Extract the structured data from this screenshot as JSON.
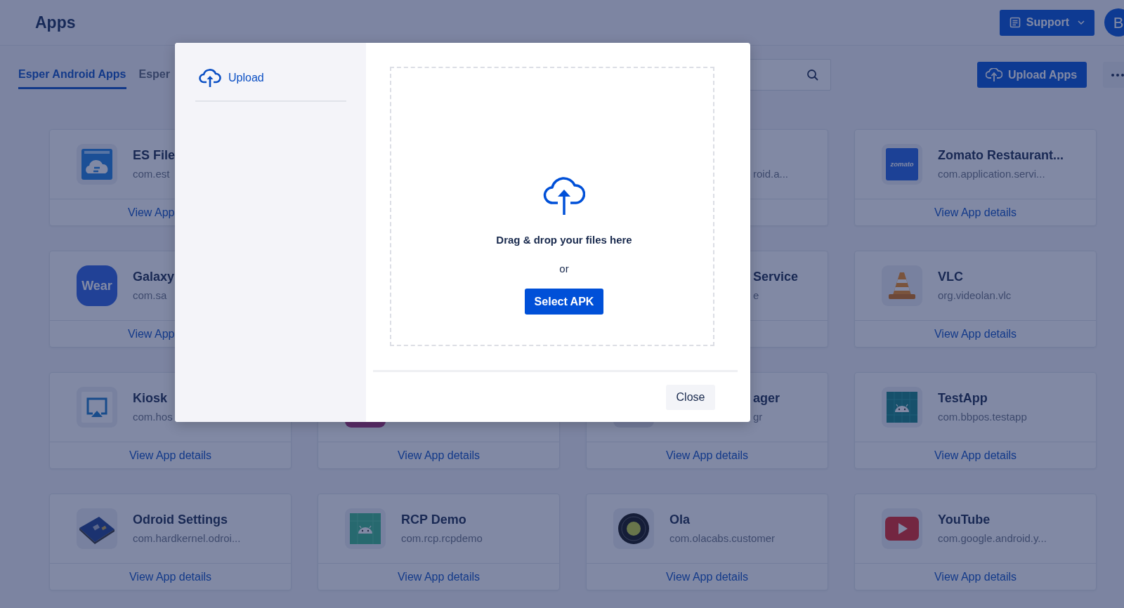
{
  "header": {
    "title": "Apps",
    "support_button": "Support",
    "avatar": "B"
  },
  "tabs": [
    {
      "label": "Esper Android Apps",
      "selected": true
    },
    {
      "label": "Esper",
      "selected": false
    }
  ],
  "upload_button": "Upload Apps",
  "card_rows": [
    [
      {
        "kind": "folder",
        "name": "ES File",
        "package": "com.est",
        "link": "View App"
      },
      {},
      {
        "package": "roid.a..."
      },
      {
        "kind": "zomato",
        "icon_label": "zomato",
        "name": "Zomato Restaurant...",
        "package": "com.application.servi...",
        "link": "View App details"
      }
    ],
    [
      {
        "kind": "wear",
        "icon_label": "Wear",
        "name": "Galaxy",
        "package": "com.sa",
        "link": "View App"
      },
      {},
      {
        "name": "Service",
        "package": "e"
      },
      {
        "kind": "cone",
        "name": "VLC",
        "package": "org.videolan.vlc",
        "link": "View App details"
      }
    ],
    [
      {
        "kind": "screen",
        "name": "Kiosk",
        "package": "com.hos",
        "link": "View App details"
      },
      {
        "kind": "pink-tile",
        "link": "View App details"
      },
      {
        "kind": "grey-tile",
        "name": "ager",
        "package": "gr",
        "link": "View App details"
      },
      {
        "kind": "android-grid",
        "name": "TestApp",
        "package": "com.bbpos.testapp",
        "link": "View App details"
      }
    ],
    [
      {
        "kind": "board",
        "name": "Odroid Settings",
        "package": "com.hardkernel.odroi...",
        "link": "View App details"
      },
      {
        "kind": "android",
        "name": "RCP Demo",
        "package": "com.rcp.rcpdemo",
        "link": "View App details"
      },
      {
        "kind": "ring",
        "name": "Ola",
        "package": "com.olacabs.customer",
        "link": "View App details"
      },
      {
        "kind": "play",
        "name": "YouTube",
        "package": "com.google.android.y...",
        "link": "View App details"
      }
    ]
  ],
  "modal": {
    "nav": [
      {
        "label": "Upload",
        "selected": true
      }
    ],
    "drop_text": "Drag & drop your files here",
    "or_text": "or",
    "select_button": "Select APK",
    "close_button": "Close"
  }
}
